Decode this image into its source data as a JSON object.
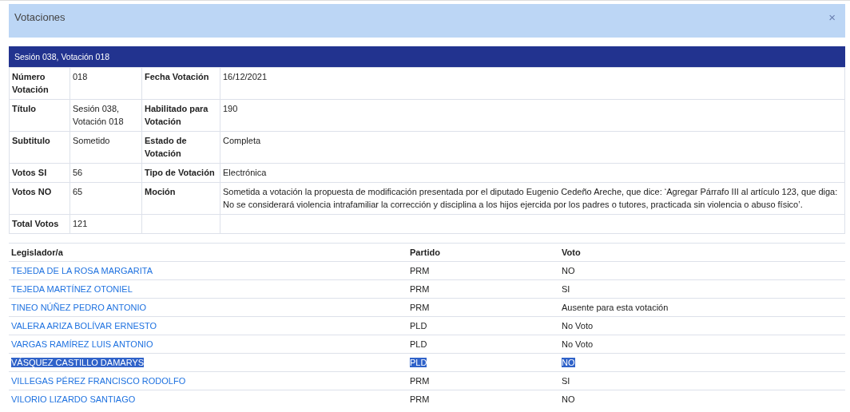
{
  "dialog": {
    "title": "Votaciones",
    "close": "×"
  },
  "details": {
    "heading": "Sesión 038, Votación 018",
    "rows": [
      {
        "cells": [
          {
            "label": "Número Votación",
            "value": "018"
          },
          {
            "label": "Fecha Votación",
            "value": "16/12/2021"
          }
        ]
      },
      {
        "cells": [
          {
            "label": "Título",
            "value": "Sesión 038, Votación 018"
          },
          {
            "label": "Habilitado para Votación",
            "value": "190"
          }
        ]
      },
      {
        "cells": [
          {
            "label": "Subtitulo",
            "value": "Sometido"
          },
          {
            "label": "Estado de Votación",
            "value": "Completa"
          }
        ]
      },
      {
        "cells": [
          {
            "label": "Votos SI",
            "value": "56"
          },
          {
            "label": "Tipo de Votación",
            "value": "Electrónica"
          }
        ]
      },
      {
        "cells": [
          {
            "label": "Votos NO",
            "value": "65"
          },
          {
            "label": "Moción",
            "value": "Sometida a votación la propuesta de modificación presentada por el diputado Eugenio Cedeño Areche, que dice: ‘Agregar Párrafo III al artículo 123, que diga: No se considerará violencia intrafamiliar la corrección y disciplina a los hijos ejercida por los padres o tutores, practicada sin violencia o abuso físico’."
          }
        ]
      },
      {
        "cells": [
          {
            "label": "Total Votos",
            "value": "121"
          }
        ]
      }
    ]
  },
  "votes": {
    "columns": [
      "Legislador/a",
      "Partido",
      "Voto"
    ],
    "rows": [
      {
        "name": "TEJEDA DE LA ROSA MARGARITA",
        "party": "PRM",
        "vote": "NO",
        "selected": false
      },
      {
        "name": "TEJEDA MARTÍNEZ OTONIEL",
        "party": "PRM",
        "vote": "SI",
        "selected": false
      },
      {
        "name": "TINEO NÚÑEZ PEDRO ANTONIO",
        "party": "PRM",
        "vote": "Ausente para esta votación",
        "selected": false
      },
      {
        "name": "VALERA ARIZA BOLÍVAR ERNESTO",
        "party": "PLD",
        "vote": "No Voto",
        "selected": false
      },
      {
        "name": "VARGAS RAMÍREZ LUIS ANTONIO",
        "party": "PLD",
        "vote": "No Voto",
        "selected": false
      },
      {
        "name": "VÁSQUEZ CASTILLO DAMARYS",
        "party": "PLD",
        "vote": "NO",
        "selected": true
      },
      {
        "name": "VILLEGAS PÉREZ FRANCISCO RODOLFO",
        "party": "PRM",
        "vote": "SI",
        "selected": false
      },
      {
        "name": "VILORIO LIZARDO SANTIAGO",
        "party": "PRM",
        "vote": "NO",
        "selected": false
      }
    ]
  }
}
